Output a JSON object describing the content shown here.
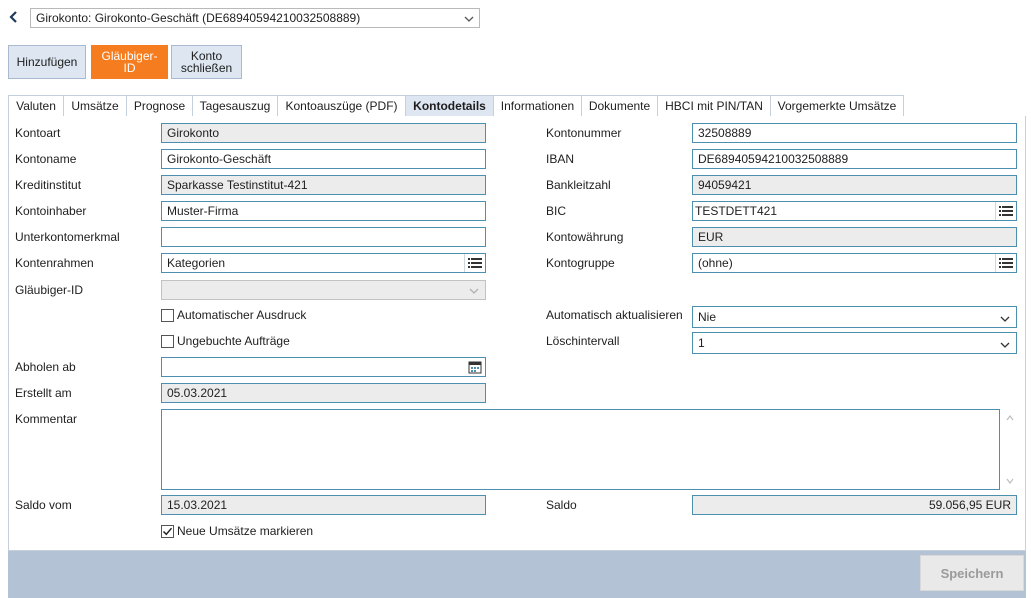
{
  "header": {
    "account_select": "Girokonto: Girokonto-Geschäft (DE68940594210032508889)"
  },
  "toolbar": {
    "add_label": "Hinzufügen",
    "creditor_label_line1": "Gläubiger-",
    "creditor_label_line2": "ID",
    "close_label_line1": "Konto",
    "close_label_line2": "schließen"
  },
  "tabs": [
    {
      "label": "Valuten"
    },
    {
      "label": "Umsätze"
    },
    {
      "label": "Prognose"
    },
    {
      "label": "Tagesauszug"
    },
    {
      "label": "Kontoauszüge (PDF)"
    },
    {
      "label": "Kontodetails"
    },
    {
      "label": "Informationen"
    },
    {
      "label": "Dokumente"
    },
    {
      "label": "HBCI mit PIN/TAN"
    },
    {
      "label": "Vorgemerkte Umsätze"
    }
  ],
  "active_tab": "Kontodetails",
  "form": {
    "kontoart": {
      "label": "Kontoart",
      "value": "Girokonto"
    },
    "kontoname": {
      "label": "Kontoname",
      "value": "Girokonto-Geschäft"
    },
    "kreditinstitut": {
      "label": "Kreditinstitut",
      "value": "Sparkasse Testinstitut-421"
    },
    "kontoinhaber": {
      "label": "Kontoinhaber",
      "value": "Muster-Firma"
    },
    "unterkontomerkmal": {
      "label": "Unterkontomerkmal",
      "value": ""
    },
    "kontenrahmen": {
      "label": "Kontenrahmen",
      "value": "Kategorien"
    },
    "glaeubiger_id": {
      "label": "Gläubiger-ID",
      "value": ""
    },
    "auto_print": {
      "label": "Automatischer Ausdruck",
      "checked": false
    },
    "unbooked": {
      "label": "Ungebuchte Aufträge",
      "checked": false
    },
    "abholen_ab": {
      "label": "Abholen ab",
      "value": ""
    },
    "erstellt_am": {
      "label": "Erstellt am",
      "value": "05.03.2021"
    },
    "kommentar": {
      "label": "Kommentar",
      "value": ""
    },
    "saldo_vom": {
      "label": "Saldo vom",
      "value": "15.03.2021"
    },
    "mark_new": {
      "label": "Neue Umsätze markieren",
      "checked": true
    },
    "kontonummer": {
      "label": "Kontonummer",
      "value": "32508889"
    },
    "iban": {
      "label": "IBAN",
      "value": "DE68940594210032508889"
    },
    "bankleitzahl": {
      "label": "Bankleitzahl",
      "value": "94059421"
    },
    "bic": {
      "label": "BIC",
      "value": "TESTDETT421"
    },
    "kontowaehrung": {
      "label": "Kontowährung",
      "value": "EUR"
    },
    "kontogruppe": {
      "label": "Kontogruppe",
      "value": "(ohne)"
    },
    "auto_update": {
      "label": "Automatisch aktualisieren",
      "value": "Nie"
    },
    "loeschintervall": {
      "label": "Löschintervall",
      "value": "1"
    },
    "saldo": {
      "label": "Saldo",
      "value": "59.056,95 EUR"
    }
  },
  "footer": {
    "save_label": "Speichern"
  },
  "colors": {
    "accent_orange": "#f57d1f",
    "tab_active_bg": "#dde6f1",
    "field_border": "#4d8fae",
    "footer_bg": "#b4c2d6"
  }
}
